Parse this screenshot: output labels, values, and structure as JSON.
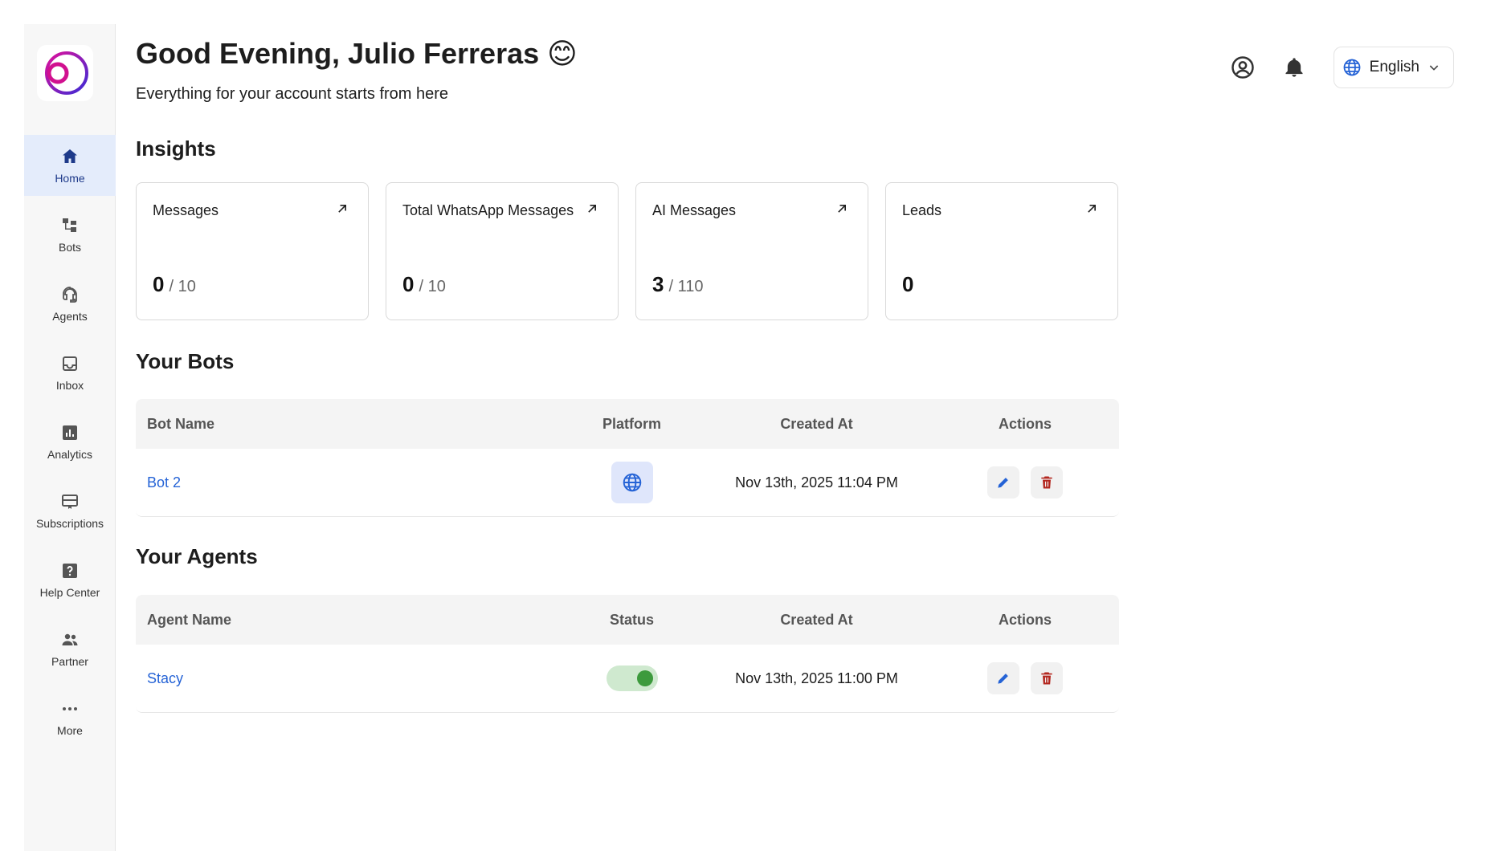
{
  "sidebar": {
    "items": [
      {
        "label": "Home",
        "icon": "home-icon",
        "active": true
      },
      {
        "label": "Bots",
        "icon": "bots-icon"
      },
      {
        "label": "Agents",
        "icon": "headset-icon"
      },
      {
        "label": "Inbox",
        "icon": "inbox-icon"
      },
      {
        "label": "Analytics",
        "icon": "analytics-icon"
      },
      {
        "label": "Subscriptions",
        "icon": "subscriptions-icon"
      },
      {
        "label": "Help Center",
        "icon": "help-icon"
      },
      {
        "label": "Partner",
        "icon": "partner-icon"
      },
      {
        "label": "More",
        "icon": "more-icon"
      }
    ]
  },
  "header": {
    "greeting": "Good Evening, Julio Ferreras",
    "emoji": "😊",
    "subtitle": "Everything for your account starts from here",
    "language": "English"
  },
  "insights": {
    "title": "Insights",
    "cards": [
      {
        "title": "Messages",
        "value": "0",
        "limit": "/ 10"
      },
      {
        "title": "Total WhatsApp Messages",
        "value": "0",
        "limit": "/ 10"
      },
      {
        "title": "AI Messages",
        "value": "3",
        "limit": "/ 110"
      },
      {
        "title": "Leads",
        "value": "0",
        "limit": ""
      }
    ]
  },
  "bots": {
    "title": "Your Bots",
    "columns": [
      "Bot Name",
      "Platform",
      "Created At",
      "Actions"
    ],
    "rows": [
      {
        "name": "Bot 2",
        "platform": "web",
        "created_at": "Nov 13th, 2025 11:04 PM"
      }
    ]
  },
  "agents": {
    "title": "Your Agents",
    "columns": [
      "Agent Name",
      "Status",
      "Created At",
      "Actions"
    ],
    "rows": [
      {
        "name": "Stacy",
        "status": "on",
        "created_at": "Nov 13th, 2025 11:00 PM"
      }
    ]
  },
  "colors": {
    "accent": "#2563d6",
    "active_nav_bg": "#e4ecfb",
    "delete": "#b3261e",
    "toggle_on": "#3d9a3d"
  }
}
